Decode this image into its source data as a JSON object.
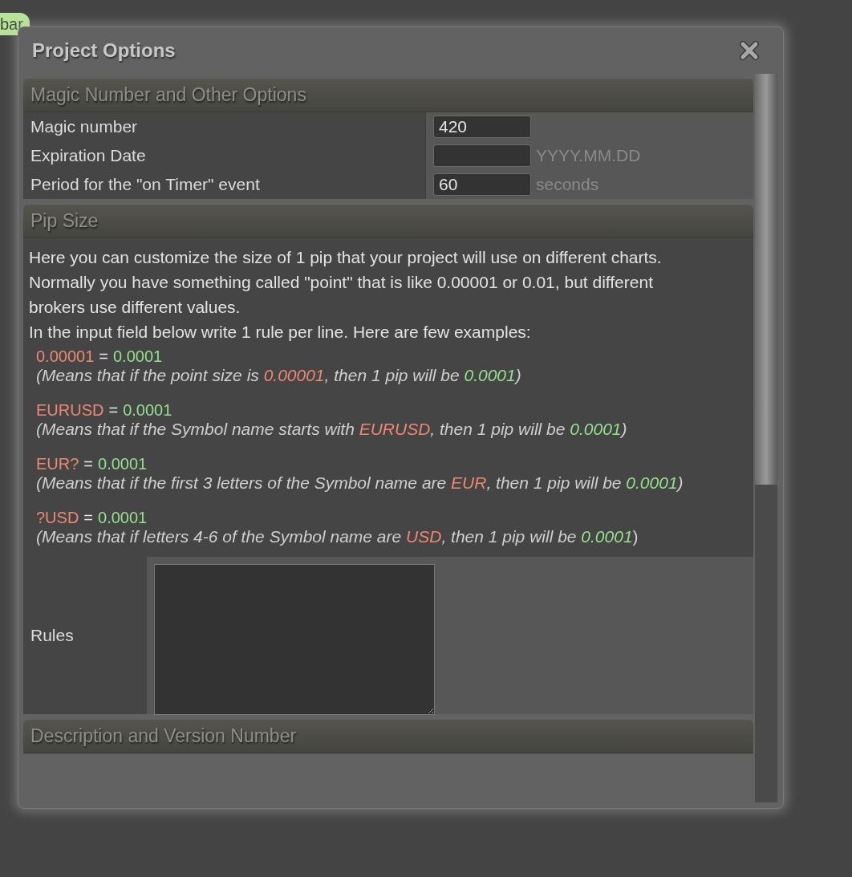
{
  "tag": {
    "label": "bar"
  },
  "window": {
    "title": "Project Options"
  },
  "sections": [
    {
      "kind": "fields",
      "title": "Magic Number and Other Options",
      "rows": [
        {
          "label": "Magic number",
          "value": "420"
        },
        {
          "label": "Expiration Date",
          "value": "",
          "hint": "YYYY.MM.DD"
        },
        {
          "label": "Period for the \"on Timer\" event",
          "value": "60",
          "hint": "seconds"
        }
      ]
    },
    {
      "kind": "pip",
      "title": "Pip Size",
      "paragraphs": [
        "Here you can customize the size of 1 pip that your project will use on different charts.",
        "Normally you have something called \"point\" that is like 0.00001 or 0.01, but different brokers use different values.",
        "In the input field below write 1 rule per line. Here are few examples:"
      ],
      "examples": [
        {
          "pattern": "0.00001",
          "equals": "=",
          "pip": "0.0001",
          "explanation": [
            {
              "kind": "text",
              "text": "(Means that if the point size is "
            },
            {
              "kind": "pattern",
              "text": "0.00001"
            },
            {
              "kind": "text",
              "text": ", then 1 pip will be "
            },
            {
              "kind": "pip",
              "text": "0.0001"
            },
            {
              "kind": "text",
              "text": ")"
            }
          ]
        },
        {
          "pattern": "EURUSD",
          "equals": "=",
          "pip": "0.0001",
          "explanation": [
            {
              "kind": "text",
              "text": "(Means that if the Symbol name starts with "
            },
            {
              "kind": "pattern",
              "text": "EURUSD"
            },
            {
              "kind": "text",
              "text": ", then 1 pip will be "
            },
            {
              "kind": "pip",
              "text": "0.0001"
            },
            {
              "kind": "text",
              "text": ")"
            }
          ]
        },
        {
          "pattern": "EUR?",
          "equals": "=",
          "pip": "0.0001",
          "explanation": [
            {
              "kind": "text",
              "text": "(Means that if the first 3 letters of the Symbol name are "
            },
            {
              "kind": "pattern",
              "text": "EUR"
            },
            {
              "kind": "text",
              "text": ", then 1 pip will be "
            },
            {
              "kind": "pip",
              "text": "0.0001"
            },
            {
              "kind": "text",
              "text": ")"
            }
          ]
        },
        {
          "pattern": "?USD",
          "equals": "=",
          "pip": "0.0001",
          "explanation": [
            {
              "kind": "text",
              "text": "(Means that if letters 4-6 of the Symbol name are "
            },
            {
              "kind": "pattern",
              "text": "USD"
            },
            {
              "kind": "text",
              "text": ", then 1 pip will be "
            },
            {
              "kind": "pip",
              "text": "0.0001"
            },
            {
              "kind": "upright",
              "text": ")"
            }
          ]
        }
      ],
      "rules_label": "Rules"
    },
    {
      "kind": "header",
      "title": "Description and Version Number"
    }
  ]
}
